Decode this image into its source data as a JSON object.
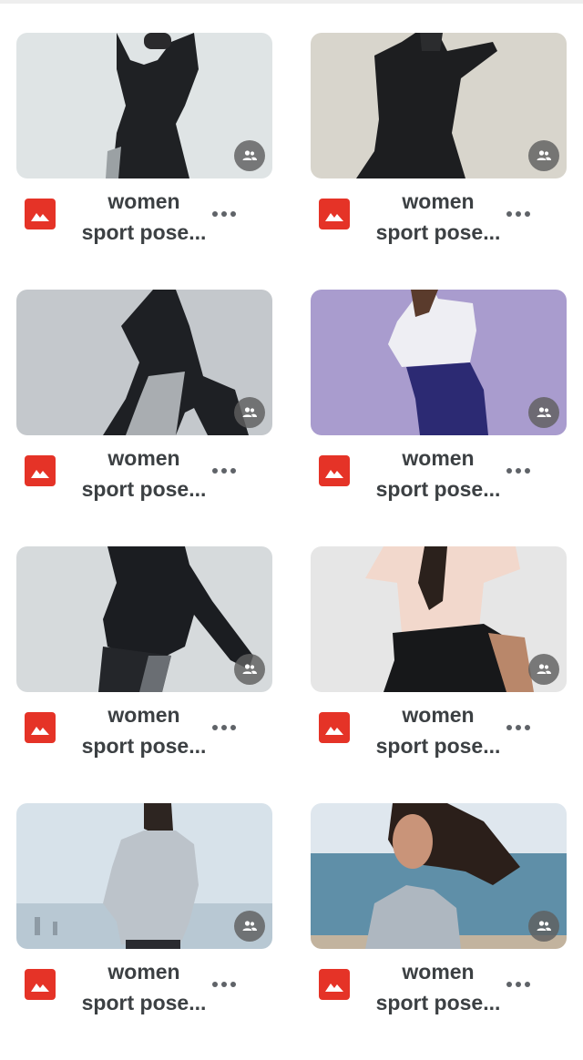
{
  "files": [
    {
      "title_line1": "women",
      "title_line2": "sport pose...",
      "thumbnail": "woman in black track jacket, arms raised, pale grey-blue background",
      "shared": true
    },
    {
      "title_line1": "women",
      "title_line2": "sport pose...",
      "thumbnail": "woman in black windbreaker, arm raised, beige background",
      "shared": true
    },
    {
      "title_line1": "women",
      "title_line2": "sport pose...",
      "thumbnail": "woman in black jacket and grey shorts lunging, grey background",
      "shared": true
    },
    {
      "title_line1": "women",
      "title_line2": "sport pose...",
      "thumbnail": "woman in white t-shirt and navy pants, lavender background",
      "shared": true
    },
    {
      "title_line1": "women",
      "title_line2": "sport pose...",
      "thumbnail": "woman in black jacket stretching, light grey background",
      "shared": true
    },
    {
      "title_line1": "women",
      "title_line2": "sport pose...",
      "thumbnail": "woman in peach t-shirt and black shorts lunging, light grey background",
      "shared": true
    },
    {
      "title_line1": "women",
      "title_line2": "sport pose...",
      "thumbnail": "woman in grey hoodie by the sea",
      "shared": true
    },
    {
      "title_line1": "women",
      "title_line2": "sport pose...",
      "thumbnail": "woman with flowing hair in grey hoodie at beach",
      "shared": true
    }
  ],
  "icons": {
    "file_type": "image-file-icon",
    "shared": "people-icon",
    "more": "more-options-icon"
  },
  "colors": {
    "file_icon": "#e53327",
    "title_text": "#3c4043",
    "badge": "#5f5f5f"
  }
}
